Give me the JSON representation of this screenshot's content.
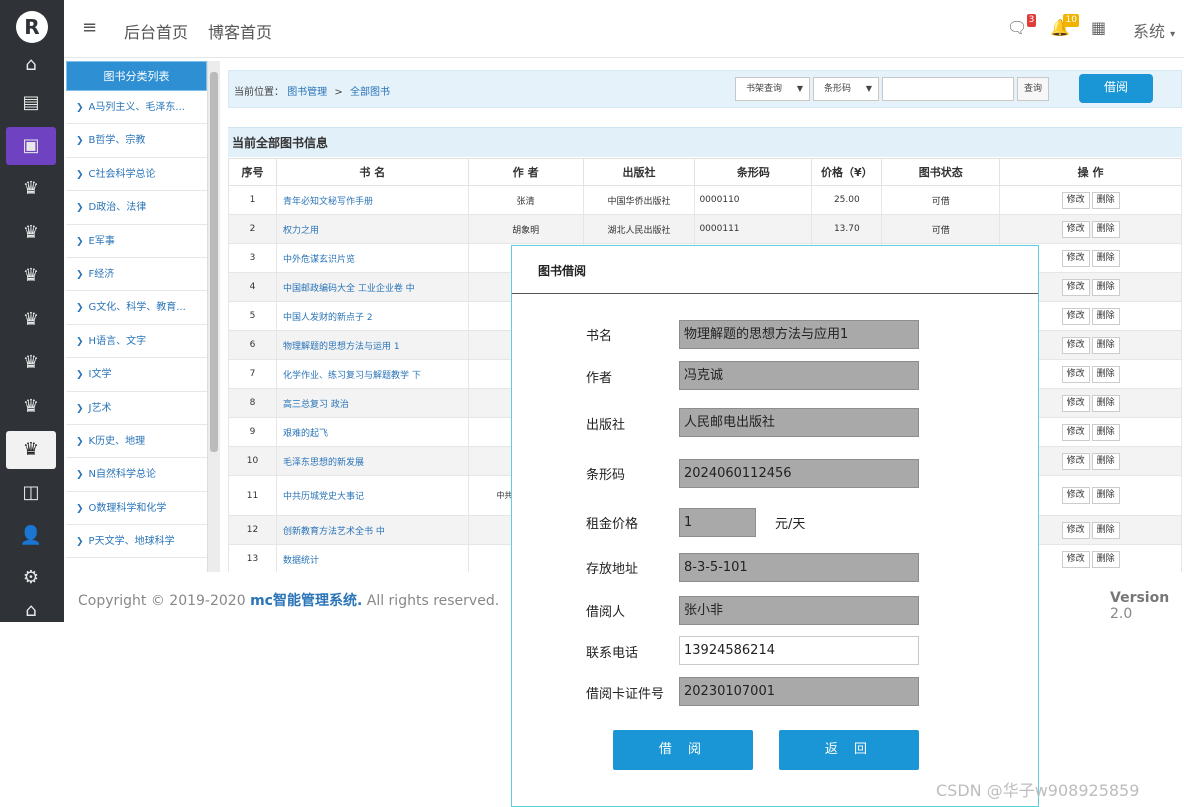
{
  "rail": {
    "logo": "R",
    "icons": [
      "home-icon",
      "list-icon",
      "card-icon",
      "crown-icon",
      "crown-icon",
      "crown-icon",
      "crown-icon",
      "crown-icon",
      "crown-icon",
      "crown-icon",
      "layout-icon",
      "user-gear-icon",
      "gear-icon",
      "home-icon"
    ]
  },
  "header": {
    "menu_icon": "≡",
    "nav": [
      "后台首页",
      "博客首页"
    ],
    "messages_badge": "3",
    "bell_badge": "10",
    "system_label": "系统"
  },
  "categories": {
    "title": "图书分类列表",
    "items": [
      "A马列主义、毛泽东...",
      "B哲学、宗教",
      "C社会科学总论",
      "D政治、法律",
      "E军事",
      "F经济",
      "G文化、科学、教育...",
      "H语言、文字",
      "I文学",
      "J艺术",
      "K历史、地理",
      "N自然科学总论",
      "O数理科学和化学",
      "P天文学、地球科学"
    ]
  },
  "breadcrumb": {
    "prefix": "当前位置：",
    "level1": "图书管理",
    "sep": ">",
    "level2": "全部图书"
  },
  "search": {
    "select1": "书架查询",
    "select2": "条形码",
    "query_button": "查询",
    "borrow_button": "借阅"
  },
  "table": {
    "title": "当前全部图书信息",
    "headers": [
      "序号",
      "书 名",
      "作 者",
      "出版社",
      "条形码",
      "价格（¥）",
      "图书状态",
      "操 作"
    ],
    "edit_label": "修改",
    "delete_label": "删除",
    "rows": [
      {
        "no": "1",
        "name": "青年必知文秘写作手册",
        "author": "张清",
        "publisher": "中国华侨出版社",
        "barcode": "0000110",
        "price": "25.00",
        "status": "可借"
      },
      {
        "no": "2",
        "name": "权力之用",
        "author": "胡象明",
        "publisher": "湖北人民出版社",
        "barcode": "0000111",
        "price": "13.70",
        "status": "可借"
      },
      {
        "no": "3",
        "name": "中外危谋玄识片览",
        "author": "",
        "publisher": "",
        "barcode": "",
        "price": "",
        "status": ""
      },
      {
        "no": "4",
        "name": "中国邮政编码大全 工业企业卷 中",
        "author": "邮电",
        "publisher": "",
        "barcode": "",
        "price": "",
        "status": ""
      },
      {
        "no": "5",
        "name": "中国人发财的新点子 2",
        "author": "",
        "publisher": "",
        "barcode": "",
        "price": "",
        "status": ""
      },
      {
        "no": "6",
        "name": "物理解题的思想方法与运用 1",
        "author": "",
        "publisher": "",
        "barcode": "",
        "price": "",
        "status": ""
      },
      {
        "no": "7",
        "name": "化学作业、练习复习与解题教学 下",
        "author": "",
        "publisher": "",
        "barcode": "",
        "price": "",
        "status": ""
      },
      {
        "no": "8",
        "name": "高三总复习 政治",
        "author": "",
        "publisher": "",
        "barcode": "",
        "price": "",
        "status": ""
      },
      {
        "no": "9",
        "name": "艰难的起飞",
        "author": "",
        "publisher": "",
        "barcode": "",
        "price": "",
        "status": ""
      },
      {
        "no": "10",
        "name": "毛泽东思想的新发展",
        "author": "王洲",
        "publisher": "",
        "barcode": "",
        "price": "",
        "status": ""
      },
      {
        "no": "11",
        "name": "中共历城党史大事记",
        "author": "中共济南 资料征",
        "publisher": "",
        "barcode": "",
        "price": "",
        "status": ""
      },
      {
        "no": "12",
        "name": "创新教育方法艺术全书 中",
        "author": "",
        "publisher": "",
        "barcode": "",
        "price": "",
        "status": ""
      },
      {
        "no": "13",
        "name": "数据统计",
        "author": "",
        "publisher": "",
        "barcode": "",
        "price": "",
        "status": ""
      }
    ]
  },
  "footer": {
    "copyright": "Copyright © 2019-2020 ",
    "brand": "mc智能管理系统.",
    "rights": " All rights reserved.",
    "version_label": "Version",
    "version": "2.0"
  },
  "modal": {
    "title": "图书借阅",
    "fields": [
      {
        "label": "书名",
        "value": "物理解题的思想方法与应用1"
      },
      {
        "label": "作者",
        "value": "冯克诚"
      },
      {
        "label": "出版社",
        "value": "人民邮电出版社"
      },
      {
        "label": "条形码",
        "value": "2024060112456"
      },
      {
        "label": "租金价格",
        "value": "1"
      },
      {
        "label": "存放地址",
        "value": "8-3-5-101"
      },
      {
        "label": "借阅人",
        "value": "张小非"
      },
      {
        "label": "联系电话",
        "value": "13924586214"
      },
      {
        "label": "借阅卡证件号",
        "value": "20230107001"
      }
    ],
    "price_unit": "元/天",
    "borrow_button": "借 阅",
    "back_button": "返 回"
  },
  "watermark": "CSDN @华子w908925859",
  "colors": {
    "accent": "#1a96d6",
    "rail": "#2f3338",
    "rail_active": "#6f42c1",
    "modal_border": "#5fcfe0"
  }
}
